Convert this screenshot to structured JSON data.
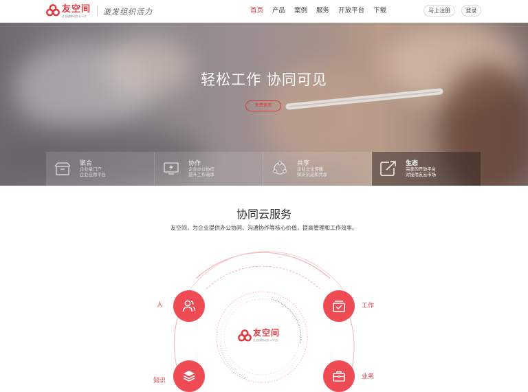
{
  "header": {
    "logo_name": "友空间",
    "logo_sub": "企业级移动办公平台",
    "slogan": "激发组织活力",
    "nav": [
      "首页",
      "产品",
      "案例",
      "服务",
      "开放平台",
      "下载"
    ],
    "register_label": "马上注册",
    "login_label": "登录"
  },
  "hero": {
    "title": "轻松工作  协同可见",
    "cta": "免费使用",
    "features": [
      {
        "title": "聚合",
        "line1": "企业级门户",
        "line2": "企业应用平台",
        "icon": "box-icon"
      },
      {
        "title": "协作",
        "line1": "企业办公协作",
        "line2": "提升工作效率",
        "icon": "lightning-screen-icon"
      },
      {
        "title": "共享",
        "line1": "企业文化传播",
        "line2": "知识沉淀和共享",
        "icon": "share-network-icon"
      },
      {
        "title": "生态",
        "line1": "完善的开放平台",
        "line2": "对接用友云市场",
        "icon": "arrow-out-icon"
      }
    ]
  },
  "section": {
    "title": "协同云服务",
    "desc": "友空间，为企业提供办公协同、沟通协作等核心价值，提高管理和工作效率。"
  },
  "diagram": {
    "center_name": "友空间",
    "center_sub": "企业级移动办公平台",
    "nodes": {
      "people": "人",
      "work": "工作",
      "knowledge": "知识",
      "business": "业务"
    }
  },
  "colors": {
    "accent": "#e0383f",
    "node": "#ef4b55"
  }
}
